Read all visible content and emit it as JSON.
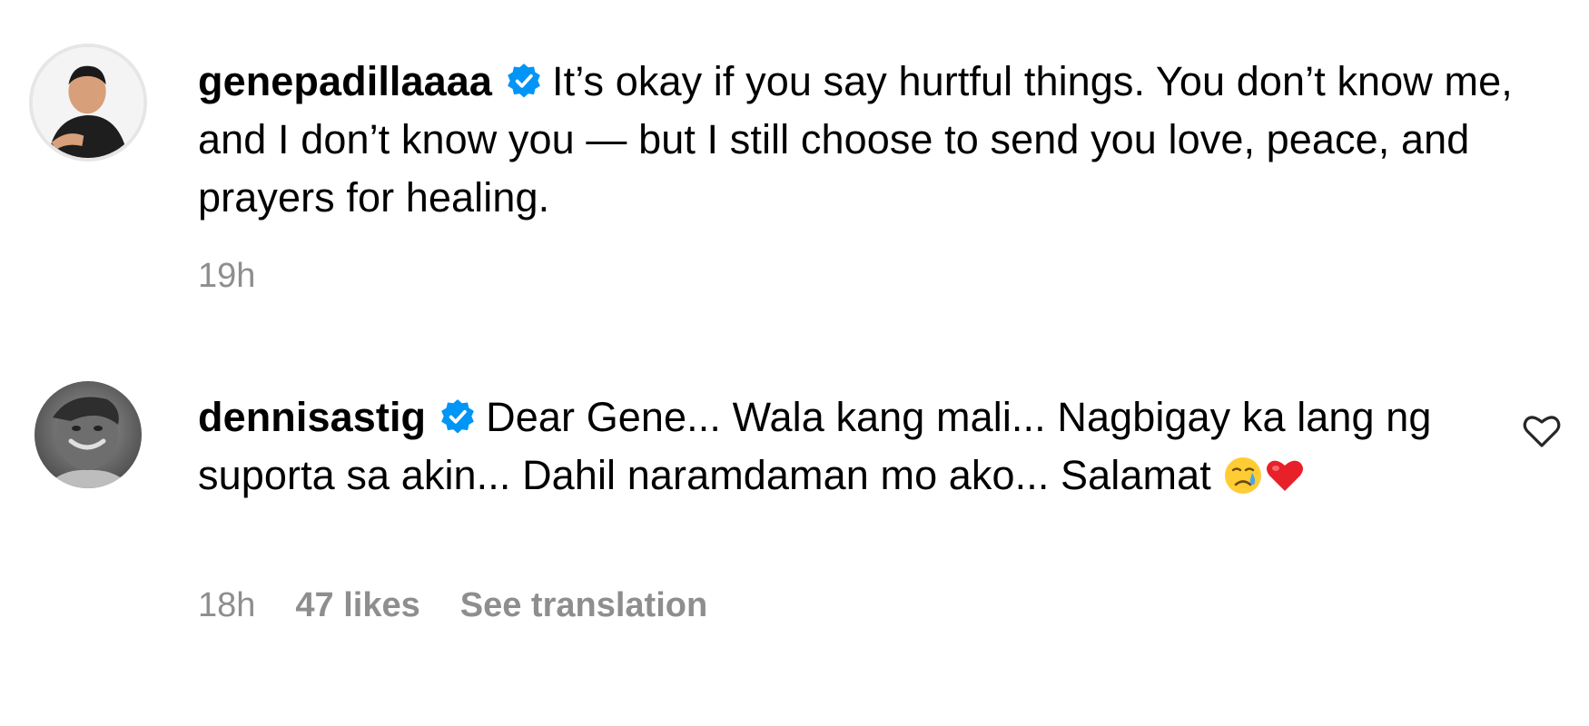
{
  "comments": [
    {
      "username": "genepadillaaaa",
      "verified": true,
      "text": "It’s okay if you say hurtful things. You don’t know me, and I don’t know you — but I still choose to send you love, peace, and prayers for healing.",
      "time": "19h"
    },
    {
      "username": "dennisastig",
      "verified": true,
      "text": "Dear Gene... Wala kang mali... Nagbigay ka lang ng suporta sa akin... Dahil naramdaman mo ako... Salamat",
      "emojis": [
        "crying-face-emoji",
        "red-heart-emoji"
      ],
      "time": "18h",
      "likes": "47 likes",
      "see_translation": "See translation"
    }
  ],
  "colors": {
    "verified_badge": "#0095f6",
    "meta_text": "#8e8e8e",
    "heart_red": "#e8202a"
  }
}
